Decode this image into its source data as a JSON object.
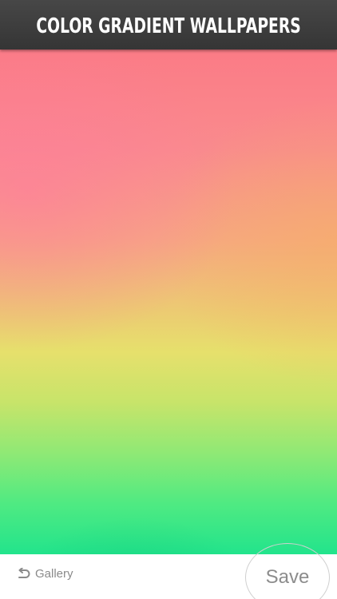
{
  "header": {
    "title": "COLOR GRADIENT WALLPAPERS"
  },
  "wallpaper": {
    "colors": {
      "top": "#fb7b86",
      "middle": "#e6e06c",
      "bottom": "#22e48c"
    }
  },
  "footer": {
    "gallery_label": "Gallery",
    "gallery_icon": "undo-arrow-icon",
    "save_label": "Save"
  }
}
